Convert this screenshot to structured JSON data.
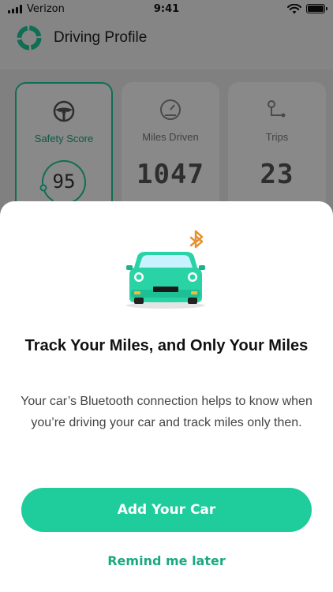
{
  "status_bar": {
    "carrier": "Verizon",
    "time": "9:41",
    "signal_icon": "signal-bars-icon",
    "wifi_icon": "wifi-icon",
    "battery_icon": "battery-icon"
  },
  "header": {
    "title": "Driving Profile",
    "logo_icon": "ring-logo-icon"
  },
  "cards": [
    {
      "label": "Safety Score",
      "value": "95",
      "icon": "steering-wheel-icon"
    },
    {
      "label": "Miles Driven",
      "value": "1047",
      "icon": "speedometer-icon"
    },
    {
      "label": "Trips",
      "value": "23",
      "icon": "route-icon"
    }
  ],
  "sheet": {
    "illustration_icon": "car-bluetooth-icon",
    "title": "Track Your Miles, and Only Your Miles",
    "body": "Your car’s Bluetooth connection helps to know when you’re driving your car and track miles only then.",
    "primary_button": "Add Your Car",
    "secondary_link": "Remind me later"
  },
  "colors": {
    "accent": "#1fcc9c",
    "accent_text": "#1aa982",
    "bluetooth": "#e8912d"
  }
}
